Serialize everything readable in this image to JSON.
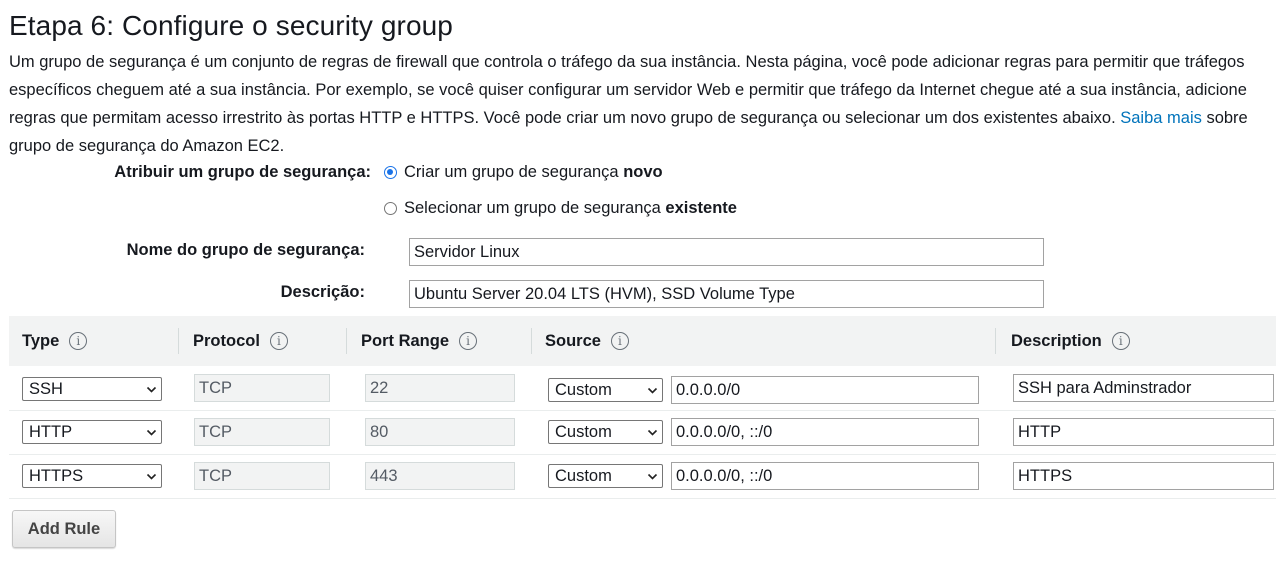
{
  "page": {
    "title": "Etapa 6: Configure o security group",
    "description_text": "Um grupo de segurança é um conjunto de regras de firewall que controla o tráfego da sua instância. Nesta página, você pode adicionar regras para permitir que tráfegos específicos cheguem até a sua instância. Por exemplo, se você quiser configurar um servidor Web e permitir que tráfego da Internet chegue até a sua instância, adicione regras que permitam acesso irrestrito às portas HTTP e HTTPS. Você pode criar um novo grupo de segurança ou selecionar um dos existentes abaixo. ",
    "learn_more_link": "Saiba mais",
    "description_suffix": " sobre grupo de segurança do Amazon EC2."
  },
  "form": {
    "assign_label": "Atribuir um grupo de segurança:",
    "option_new_prefix": "Criar um grupo de segurança ",
    "option_new_bold": "novo",
    "option_existing_prefix": "Selecionar um grupo de segurança ",
    "option_existing_bold": "existente",
    "selected_option": "new",
    "name_label": "Nome do grupo de segurança:",
    "name_value": "Servidor Linux",
    "description_label": "Descrição:",
    "description_value": "Ubuntu Server 20.04 LTS (HVM), SSD Volume Type"
  },
  "table": {
    "headers": {
      "type": "Type",
      "protocol": "Protocol",
      "port_range": "Port Range",
      "source": "Source",
      "description": "Description"
    },
    "info_icon_glyph": "i",
    "rows": [
      {
        "type": "SSH",
        "protocol": "TCP",
        "port_range": "22",
        "source_type": "Custom",
        "source_value": "0.0.0.0/0",
        "description": "SSH para Adminstrador"
      },
      {
        "type": "HTTP",
        "protocol": "TCP",
        "port_range": "80",
        "source_type": "Custom",
        "source_value": "0.0.0.0/0, ::/0",
        "description": "HTTP"
      },
      {
        "type": "HTTPS",
        "protocol": "TCP",
        "port_range": "443",
        "source_type": "Custom",
        "source_value": "0.0.0.0/0, ::/0",
        "description": "HTTPS"
      }
    ]
  },
  "actions": {
    "add_rule_label": "Add Rule"
  },
  "colors": {
    "link": "#0073bb",
    "radio_selected": "#1a73e8",
    "header_bg": "#f2f3f3",
    "text": "#16191f"
  }
}
